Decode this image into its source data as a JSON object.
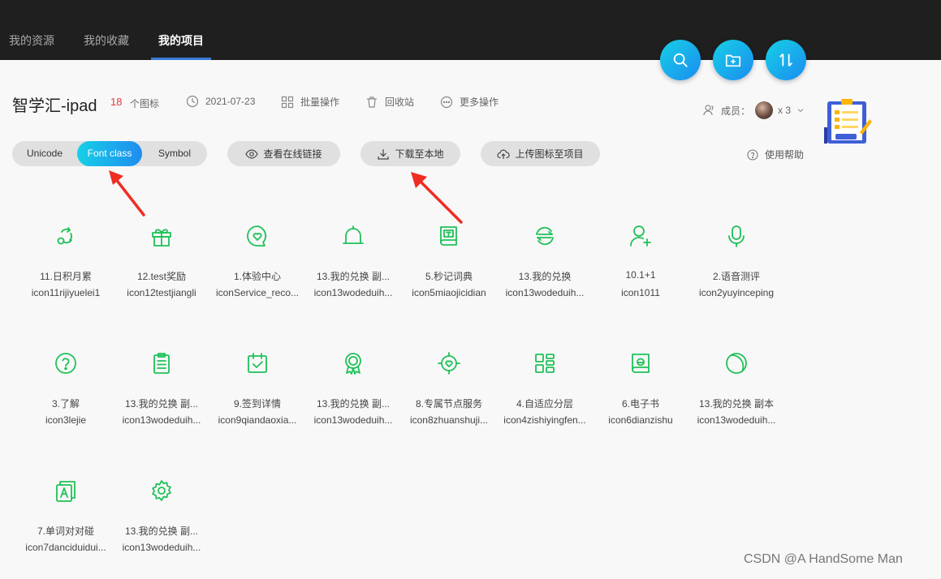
{
  "nav": {
    "tabs": [
      {
        "label": "我的资源"
      },
      {
        "label": "我的收藏"
      },
      {
        "label": "我的项目"
      }
    ],
    "active_index": 2
  },
  "fab_buttons": [
    {
      "icon": "search-icon"
    },
    {
      "icon": "add-folder-icon"
    },
    {
      "icon": "sort-icon"
    }
  ],
  "project": {
    "title": "智学汇-ipad",
    "icon_count": "18",
    "icon_count_unit": "个图标",
    "date": "2021-07-23",
    "batch_label": "批量操作",
    "recycle_label": "回收站",
    "more_label": "更多操作",
    "members_label": "成员：",
    "members_count": "x 3"
  },
  "toolbar": {
    "format_tabs": [
      {
        "label": "Unicode"
      },
      {
        "label": "Font class"
      },
      {
        "label": "Symbol"
      }
    ],
    "active_format": 1,
    "view_link_label": "查看在线链接",
    "download_label": "下载至本地",
    "upload_label": "上传图标至项目",
    "help_label": "使用帮助"
  },
  "icons": [
    {
      "name": "11.日积月累",
      "code": "icon11rijiyuelei1",
      "glyph": "rotate"
    },
    {
      "name": "12.test奖励",
      "code": "icon12testjiangli",
      "glyph": "gift"
    },
    {
      "name": "1.体验中心",
      "code": "iconService_reco...",
      "glyph": "heart-chat"
    },
    {
      "name": "13.我的兑换 副...",
      "code": "icon13wodeduih...",
      "glyph": "bell"
    },
    {
      "name": "5.秒记词典",
      "code": "icon5miaojicidian",
      "glyph": "book-t"
    },
    {
      "name": "13.我的兑换",
      "code": "icon13wodeduih...",
      "glyph": "exchange"
    },
    {
      "name": "10.1+1",
      "code": "icon1011",
      "glyph": "user-plus"
    },
    {
      "name": "2.语音测评",
      "code": "icon2yuyinceping",
      "glyph": "mic"
    },
    {
      "name": "3.了解",
      "code": "icon3lejie",
      "glyph": "question"
    },
    {
      "name": "13.我的兑换 副...",
      "code": "icon13wodeduih...",
      "glyph": "clipboard"
    },
    {
      "name": "9.签到详情",
      "code": "icon9qiandaoxia...",
      "glyph": "calendar-check"
    },
    {
      "name": "13.我的兑换 副...",
      "code": "icon13wodeduih...",
      "glyph": "medal"
    },
    {
      "name": "8.专属节点服务",
      "code": "icon8zhuanshuji...",
      "glyph": "heart-badge"
    },
    {
      "name": "4.自适应分层",
      "code": "icon4zishiyingfen...",
      "glyph": "grid"
    },
    {
      "name": "6.电子书",
      "code": "icon6dianzishu",
      "glyph": "ebook"
    },
    {
      "name": "13.我的兑换 副本",
      "code": "icon13wodeduih...",
      "glyph": "ball"
    },
    {
      "name": "7.单词对对碰",
      "code": "icon7danciduidui...",
      "glyph": "cards-a"
    },
    {
      "name": "13.我的兑换 副...",
      "code": "icon13wodeduih...",
      "glyph": "gear"
    }
  ],
  "colors": {
    "accent": "#1fc157",
    "brand_gradient_start": "#16d0e6",
    "brand_gradient_end": "#1b8cf0",
    "count_red": "#e4393c",
    "arrow_red": "#f02d22"
  },
  "watermark": "CSDN @A HandSome Man"
}
